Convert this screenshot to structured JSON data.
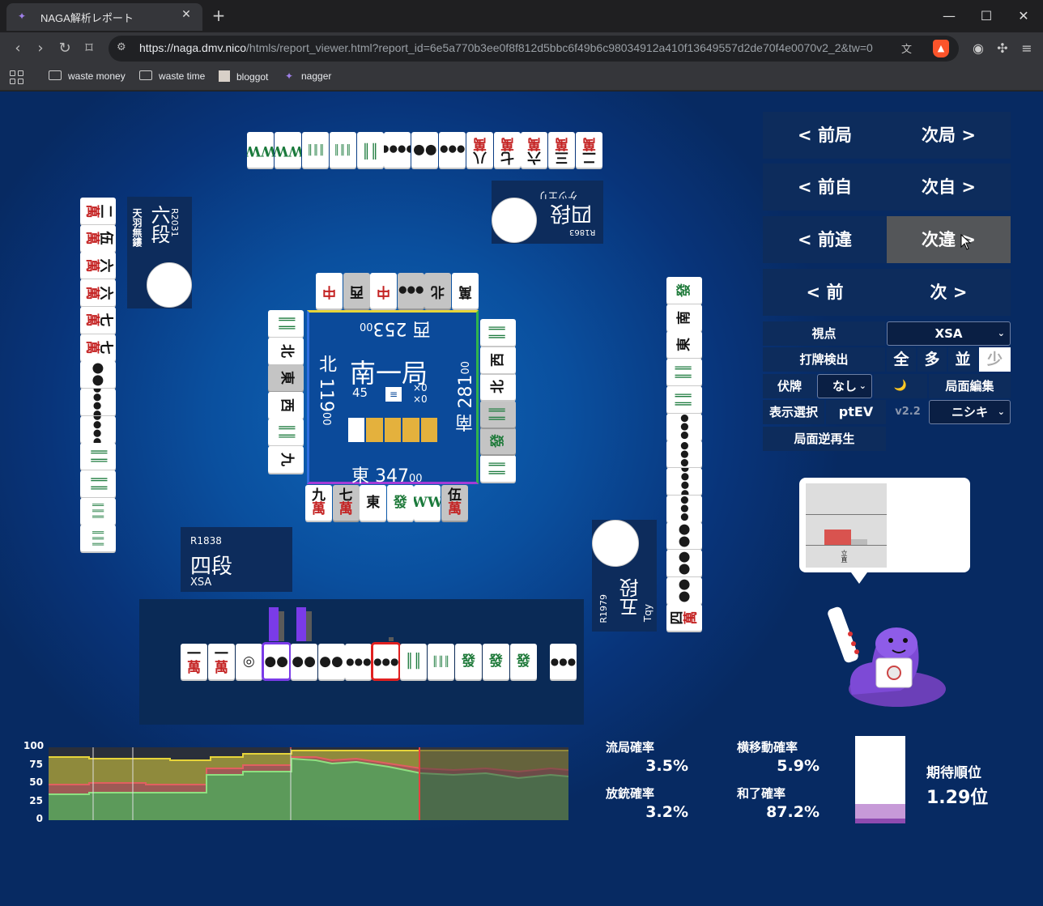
{
  "browser": {
    "tab_title": "NAGA解析レポート",
    "tab_close": "✕",
    "new_tab": "+",
    "url_host": "https://naga.dmv.nico",
    "url_path": "/htmls/report_viewer.html?report_id=6e5a770b3ee0f8f812d5bbc6f49b6c98034912a410f13649557d2de70f4e0070v2_2&tw=0",
    "bookmarks": [
      "waste money",
      "waste time",
      "bloggot",
      "nagger"
    ]
  },
  "players": {
    "left": {
      "rating": "R2031",
      "rank": "六段",
      "name": "天羽無鏤"
    },
    "top": {
      "rating": "R1863",
      "rank": "四段",
      "name": "ケツエリ"
    },
    "right": {
      "rating": "R1979",
      "rank": "五段",
      "name": "Tqy"
    },
    "bottom": {
      "rating": "R1838",
      "rank": "四段",
      "name": "XSA"
    }
  },
  "center": {
    "round": "南一局",
    "wall_count": "45",
    "honba": "×0",
    "kyotaku": "×0",
    "stick_label": "≡",
    "scores": {
      "top": {
        "wind": "西",
        "pts": "253",
        "sub": "00"
      },
      "left": {
        "wind": "北",
        "pts": "119",
        "sub": "00"
      },
      "right": {
        "wind": "南",
        "pts": "281",
        "sub": "00"
      },
      "bottom": {
        "wind": "東",
        "pts": "347",
        "sub": "00"
      }
    }
  },
  "tiles": {
    "top_hand": [
      [
        "二",
        "萬"
      ],
      [
        "三",
        "萬"
      ],
      [
        "六",
        "萬"
      ],
      [
        "七",
        "萬"
      ],
      [
        "八",
        "萬"
      ],
      [
        "●●●",
        ""
      ],
      [
        "●●",
        ""
      ],
      [
        "●●●●",
        ""
      ],
      [
        "║║",
        ""
      ],
      [
        "║║║",
        ""
      ],
      [
        "║║║",
        ""
      ],
      [
        "WW",
        ""
      ],
      [
        "WW",
        ""
      ]
    ],
    "left_hand": [
      [
        "二",
        "萬"
      ],
      [
        "伍",
        "萬"
      ],
      [
        "六",
        "萬"
      ],
      [
        "六",
        "萬"
      ],
      [
        "七",
        "萬"
      ],
      [
        "七",
        "萬"
      ],
      [
        "●●",
        ""
      ],
      [
        "●●●●",
        ""
      ],
      [
        "●●●●",
        ""
      ],
      [
        "║║",
        ""
      ],
      [
        "║║",
        ""
      ],
      [
        "║║║",
        ""
      ],
      [
        "║║║",
        ""
      ]
    ],
    "right_hand": [
      [
        "發",
        ""
      ],
      [
        "南",
        ""
      ],
      [
        "東",
        ""
      ],
      [
        "║║",
        ""
      ],
      [
        "║║",
        ""
      ],
      [
        "●●●",
        ""
      ],
      [
        "●●●",
        ""
      ],
      [
        "●●●●",
        ""
      ],
      [
        "●●●",
        ""
      ],
      [
        "●●",
        ""
      ],
      [
        "●●",
        ""
      ],
      [
        "●●",
        ""
      ],
      [
        "四",
        "萬"
      ]
    ],
    "bottom_hand": [
      [
        "一",
        "萬"
      ],
      [
        "一",
        "萬"
      ],
      [
        "◎",
        ""
      ],
      [
        "●●",
        ""
      ],
      [
        "●●",
        ""
      ],
      [
        "●●",
        ""
      ],
      [
        "●●●",
        ""
      ],
      [
        "●●●",
        ""
      ],
      [
        "║║",
        ""
      ],
      [
        "║║║",
        ""
      ],
      [
        "發",
        ""
      ],
      [
        "發",
        ""
      ],
      [
        "發",
        ""
      ]
    ],
    "bottom_draw": [
      "●●●",
      ""
    ],
    "top_discards": [
      "萬",
      "北",
      "●●●",
      "中",
      "西",
      "中"
    ],
    "left_discards": [
      "║║",
      "北",
      "東",
      "西",
      "║║",
      "九"
    ],
    "right_discards": [
      "║║",
      "發",
      "║║",
      "北",
      "西",
      "║║"
    ],
    "bottom_discards": [
      [
        "九",
        "萬"
      ],
      [
        "七",
        "萬"
      ],
      [
        "東",
        ""
      ],
      [
        "發",
        ""
      ],
      [
        "WW",
        ""
      ],
      [
        "伍",
        "萬"
      ]
    ]
  },
  "controls": {
    "rows": [
      {
        "prev": "< 前局",
        "next": "次局 >"
      },
      {
        "prev": "< 前自",
        "next": "次自 >"
      },
      {
        "prev": "< 前違",
        "next": "次違 >"
      },
      {
        "prev": "< 前",
        "next": "次 >"
      }
    ],
    "viewpoint_label": "視点",
    "viewpoint_value": "XSA",
    "detect_label": "打牌検出",
    "detect_opts": [
      "全",
      "多",
      "並",
      "少"
    ],
    "fuse_label": "伏牌",
    "fuse_value": "なし",
    "moon_icon": "🌙",
    "edit_label": "局面編集",
    "display_label": "表示選択",
    "ptev_label": "ptEV",
    "version": "v2.2",
    "model_value": "ニシキ",
    "replay_label": "局面逆再生"
  },
  "bubble": {
    "bar_label": "立直"
  },
  "graph": {
    "y_ticks": [
      "100",
      "75",
      "50",
      "25",
      "0"
    ]
  },
  "stats": {
    "ryukyoku_label": "流局確率",
    "ryukyoku_value": "3.5%",
    "yokoido_label": "横移動確率",
    "yokoido_value": "5.9%",
    "houju_label": "放銃確率",
    "houju_value": "3.2%",
    "hora_label": "和了確率",
    "hora_value": "87.2%",
    "expected_label": "期待順位",
    "expected_value": "1.29位"
  },
  "colors": {
    "accent_purple": "#7a3be8",
    "highlight_red": "#e02020",
    "panel": "#0d2c5c"
  }
}
